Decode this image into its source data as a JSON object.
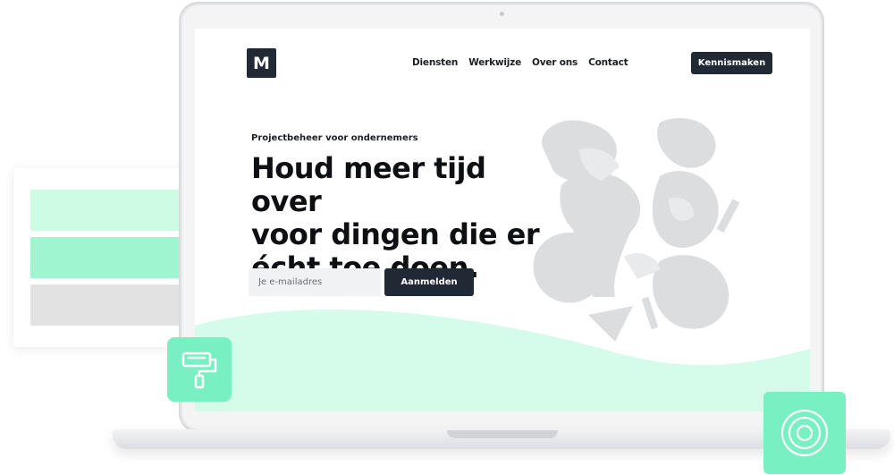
{
  "site": {
    "logo_letter": "M",
    "nav": [
      {
        "label": "Diensten"
      },
      {
        "label": "Werkwijze"
      },
      {
        "label": "Over ons"
      },
      {
        "label": "Contact"
      }
    ],
    "cta_label": "Kennismaken"
  },
  "hero": {
    "eyebrow": "Projectbeheer voor ondernemers",
    "headline_lines": [
      "Houd meer tijd over",
      "voor dingen die er",
      "écht toe doen."
    ],
    "email_placeholder": "Je e-mailadres",
    "signup_label": "Aanmelden"
  },
  "icons": {
    "illustration": "abstract-people-illustration",
    "left_tile": "paint-roller-icon",
    "right_tile": "target-icon"
  },
  "colors": {
    "dark": "#212934",
    "mint": "#79f0c1",
    "mint_light": "#cefbe3",
    "mint_mid": "#9ef5cf",
    "wave": "#d5fbeb",
    "gray_shapes": "#d9dadc"
  }
}
